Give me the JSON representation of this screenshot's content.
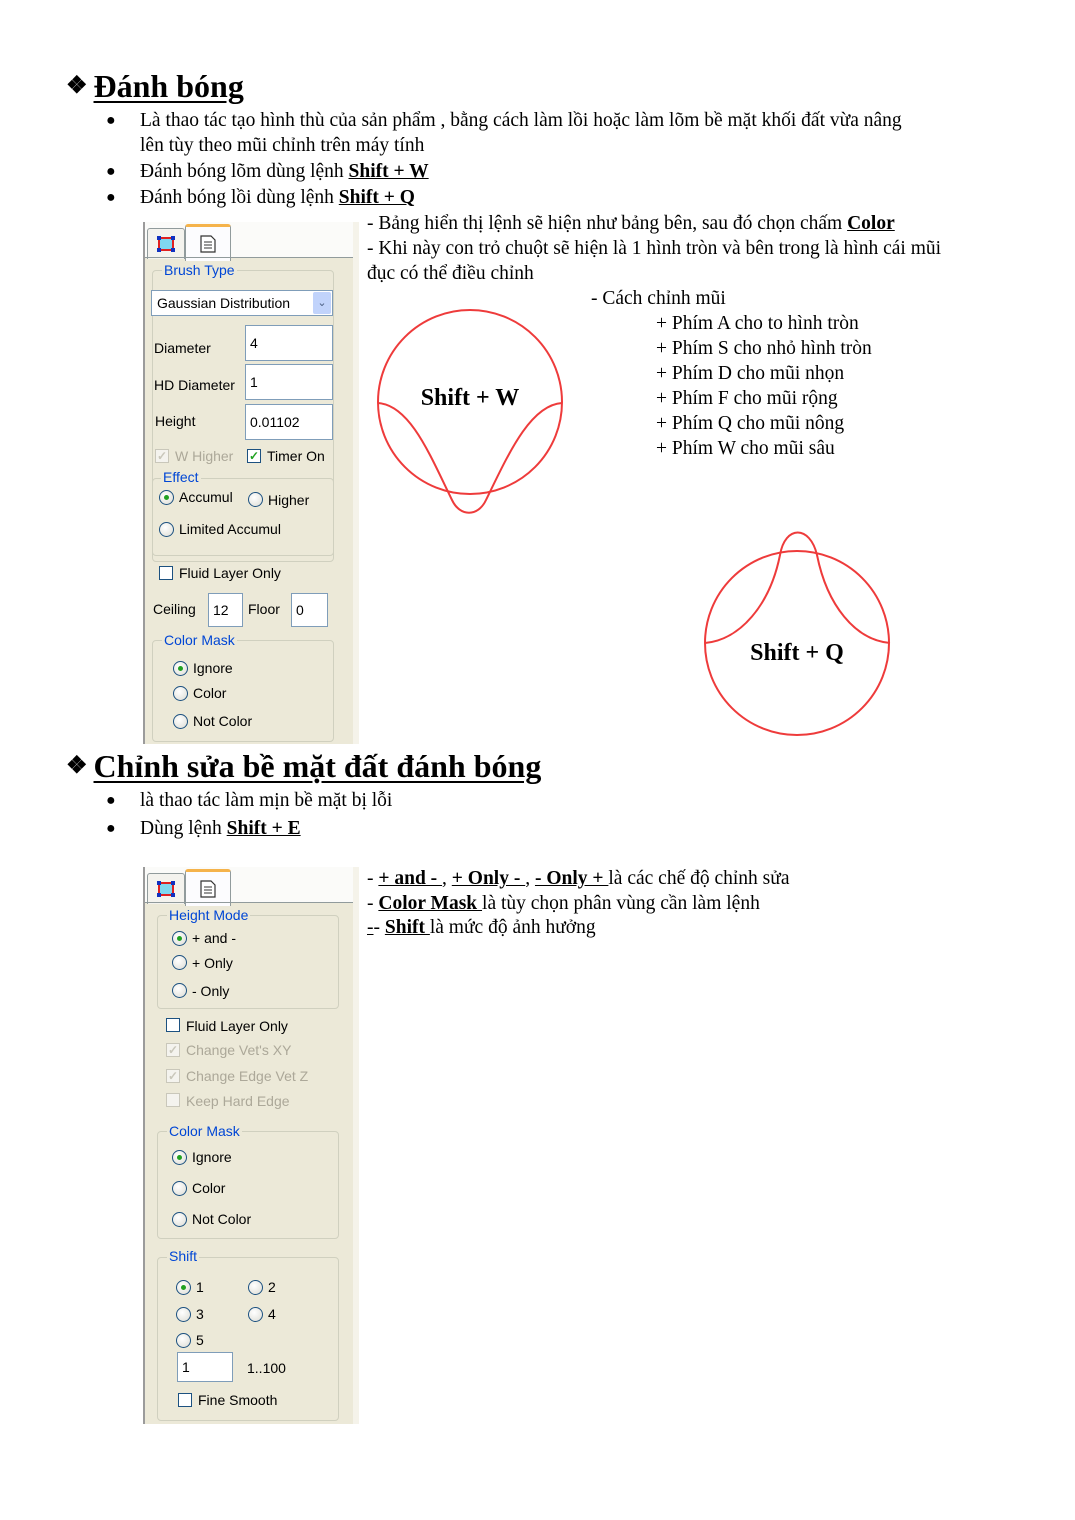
{
  "section1": {
    "heading": "Đánh bóng",
    "bullets": [
      {
        "text_line1": "Là thao tác tạo hình thù của sản phẩm , bằng cách làm lồi hoặc làm lõm bề mặt khối đất vừa nâng",
        "text_line2": "lên tùy theo mũi chỉnh trên máy tính"
      },
      {
        "text": "Đánh bóng lõm dùng lệnh ",
        "shortcut": "Shift + W"
      },
      {
        "text": "Đánh bóng lồi dùng lệnh ",
        "shortcut": "Shift + Q"
      }
    ],
    "notes": {
      "line1_prefix": "- Bảng hiển thị lệnh sẽ hiện như bảng bên, sau đó chọn chấm ",
      "line1_bold": "Color",
      "line2": "- Khi này con trỏ chuột sẽ  hiện là 1 hình tròn và bên trong là hình cái mũi",
      "line3": "đục có thể điều chỉnh",
      "adjust_title": "- Cách chỉnh mũi",
      "adjust_items": [
        "+ Phím A cho to hình tròn",
        "+ Phím S cho nhỏ hình tròn",
        "+ Phím D cho mũi nhọn",
        "+ Phím F cho mũi rộng",
        "+ Phím Q cho mũi nông",
        "+ Phím W cho mũi sâu"
      ]
    },
    "diagrams": {
      "concave_label": "Shift + W",
      "convex_label": "Shift + Q",
      "stroke_color": "#ee3b3b"
    },
    "panel": {
      "tabs": [
        "brush-tab",
        "properties-tab"
      ],
      "brush_type_label": "Brush Type",
      "brush_type_value": "Gaussian Distribution",
      "diameter_label": "Diameter",
      "diameter_value": "4",
      "hd_diameter_label": "HD Diameter",
      "hd_diameter_value": "1",
      "height_label": "Height",
      "height_value": "0.01102",
      "w_higher_label": "W Higher",
      "w_higher_checked": true,
      "timer_on_label": "Timer On",
      "timer_on_checked": true,
      "effect_label": "Effect",
      "effect_options": [
        "Accumul",
        "Higher",
        "Limited Accumul"
      ],
      "effect_selected": "Accumul",
      "fluid_layer_label": "Fluid Layer Only",
      "fluid_layer_checked": false,
      "ceiling_label": "Ceiling",
      "ceiling_value": "12",
      "floor_label": "Floor",
      "floor_value": "0",
      "color_mask_label": "Color Mask",
      "color_mask_options": [
        "Ignore",
        "Color",
        "Not Color"
      ],
      "color_mask_selected": "Ignore"
    }
  },
  "section2": {
    "heading": "Chỉnh sửa bề mặt đất đánh bóng",
    "bullets": [
      {
        "text": "là thao tác làm mịn bề mặt bị lỗi"
      },
      {
        "text": "Dùng lệnh ",
        "shortcut": "Shift + E"
      }
    ],
    "notes": {
      "line1": {
        "dash": "- ",
        "m1": "+ and - ",
        "sep1": ", ",
        "m2": "+ Only - ",
        "sep2": " , ",
        "m3": "- Only + ",
        "rest": " là các chế độ chỉnh sửa"
      },
      "line2": {
        "dash": "- ",
        "bold": "Color Mask ",
        "rest": "là tùy chọn phân vùng cần làm lệnh"
      },
      "line3": {
        "dash": "-",
        "dash2": "- ",
        "bold": "Shift ",
        "rest": " là mức độ ảnh hưởng"
      }
    },
    "panel": {
      "height_mode_label": "Height Mode",
      "height_mode_options": [
        "+ and -",
        "+ Only",
        "- Only"
      ],
      "height_mode_selected": "+ and -",
      "fluid_layer_label": "Fluid Layer Only",
      "fluid_layer_checked": false,
      "change_vets_xy_label": "Change Vet's XY",
      "change_vets_xy_checked": true,
      "change_edge_vet_z_label": "Change Edge Vet Z",
      "change_edge_vet_z_checked": true,
      "keep_hard_edge_label": "Keep Hard Edge",
      "keep_hard_edge_checked": false,
      "color_mask_label": "Color Mask",
      "color_mask_options": [
        "Ignore",
        "Color",
        "Not Color"
      ],
      "color_mask_selected": "Ignore",
      "shift_label": "Shift",
      "shift_options": [
        "1",
        "2",
        "3",
        "4",
        "5"
      ],
      "shift_selected": "1",
      "shift_value": "1",
      "shift_range": "1..100",
      "fine_smooth_label": "Fine Smooth",
      "fine_smooth_checked": false
    }
  }
}
